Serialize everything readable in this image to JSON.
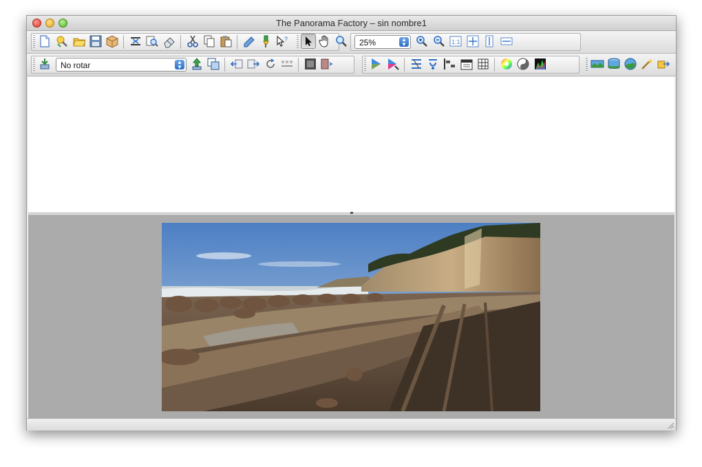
{
  "window": {
    "title": "The Panorama Factory – sin nombre1"
  },
  "toolbar_main": {
    "file_group": [
      "new-document-icon",
      "open-project-icon",
      "open-folder-icon",
      "save-icon",
      "package-icon"
    ],
    "view_group": [
      "stitch-icon",
      "preview-icon",
      "eraser-icon"
    ],
    "edit_group": [
      "cut-icon",
      "copy-icon",
      "paste-icon"
    ],
    "tools_group": [
      "pencil-icon",
      "marker-icon",
      "help-pointer-icon"
    ],
    "navigation_group": [
      "select-arrow-icon",
      "hand-pan-icon",
      "zoom-tool-icon"
    ],
    "zoom_level": "25%",
    "zoom_group": [
      "zoom-in-icon",
      "zoom-out-icon",
      "actual-size-icon",
      "fit-window-icon",
      "fit-height-icon",
      "fit-width-icon"
    ]
  },
  "toolbar_secondary": {
    "rotation_select": "No rotar",
    "align_group": [
      "rotate-import-icon",
      "move-up-icon",
      "duplicate-frame-icon"
    ],
    "transform_group": [
      "flip-left-icon",
      "flip-right-icon",
      "rotate-frames-icon",
      "strip-icon"
    ],
    "film_group": [
      "filmstrip-icon",
      "crop-frame-icon"
    ],
    "color_group": [
      "color-triangle-icon",
      "color-triangle-pick-icon"
    ],
    "layout_group": [
      "stack-icon",
      "link-icon",
      "align-left-icon",
      "calendar-icon",
      "grid-icon"
    ],
    "adjust_group": [
      "color-wheel-icon",
      "yin-yang-icon",
      "histogram-icon"
    ],
    "panorama_group": [
      "panorama-flat-icon",
      "cylinder-icon",
      "sphere-icon",
      "magic-wand-icon",
      "export-icon"
    ]
  },
  "colors": {
    "workspace_bg": "#ababab",
    "window_bg": "#ececec",
    "accent_blue": "#2d6fc4"
  }
}
